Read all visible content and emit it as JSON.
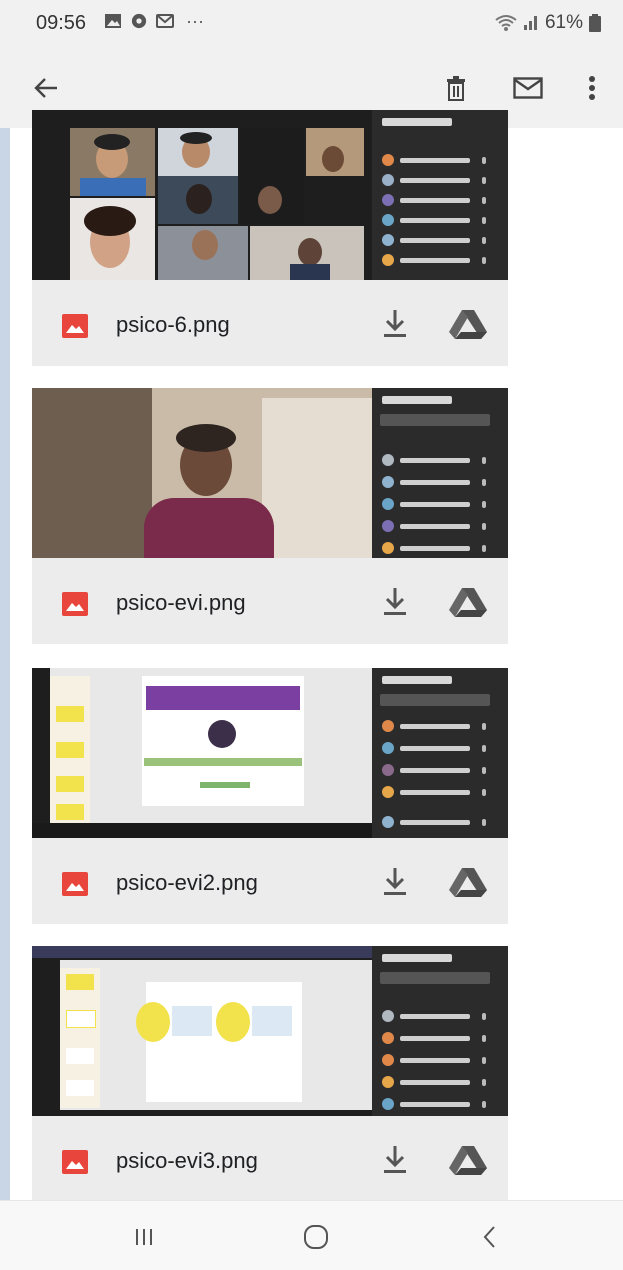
{
  "status_bar": {
    "time": "09:56",
    "notification_icons": [
      "gallery-icon",
      "app-icon",
      "message-icon"
    ],
    "more": "···",
    "battery": "61%"
  },
  "app_bar": {
    "actions": [
      "back-arrow-icon",
      "trash-icon",
      "mail-icon",
      "more-vert-icon"
    ]
  },
  "attachments": [
    {
      "filename": "psico-6.png",
      "kind": "image",
      "actions": [
        "download-icon",
        "drive-icon"
      ]
    },
    {
      "filename": "psico-evi.png",
      "kind": "image",
      "actions": [
        "download-icon",
        "drive-icon"
      ]
    },
    {
      "filename": "psico-evi2.png",
      "kind": "image",
      "actions": [
        "download-icon",
        "drive-icon"
      ]
    },
    {
      "filename": "psico-evi3.png",
      "kind": "image",
      "actions": [
        "download-icon",
        "drive-icon"
      ]
    }
  ],
  "nav_bar": {
    "buttons": [
      "recent-apps-icon",
      "home-icon",
      "back-icon"
    ]
  },
  "colors": {
    "image_icon": "#e8453c",
    "panel": "#2b2b2b",
    "slide_header": "#7a3fa0",
    "accent_yellow": "#f2e34c"
  }
}
